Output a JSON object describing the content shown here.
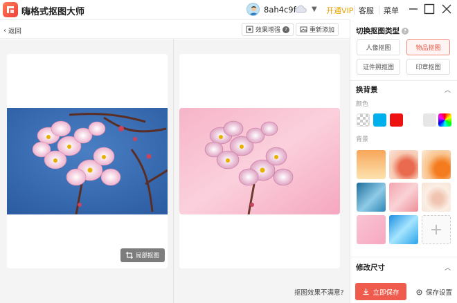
{
  "app": {
    "title": "嗨格式抠图大师"
  },
  "user": {
    "name": "8ah4c9f",
    "vip_label": "开通VIP",
    "service_label": "客服",
    "menu_label": "菜单"
  },
  "toolbar": {
    "back_label": "返回",
    "effect_label": "效果增强",
    "effect_help": "?",
    "readd_label": "重新添加"
  },
  "work": {
    "local_cutout_label": "局部抠图",
    "unsatisfied_label": "抠图效果不满意?"
  },
  "side": {
    "switch_type_title": "切换抠图类型",
    "types": [
      {
        "label": "人像抠图",
        "active": false
      },
      {
        "label": "物品抠图",
        "active": true
      },
      {
        "label": "证件照抠图",
        "active": false
      },
      {
        "label": "印章抠图",
        "active": false
      }
    ],
    "replace_bg_title": "换背景",
    "color_label": "颜色",
    "colors": [
      "transparent",
      "#00b0ec",
      "#ee1111",
      "#ffffff",
      "#e6e6e6",
      "rainbow"
    ],
    "bg_label": "背景",
    "backgrounds": [
      "bg-peach",
      "bg-flower-coral",
      "bg-orange-glow",
      "bg-blue-wave",
      "bg-pink-abstract",
      "bg-cream-floral",
      "bg-pink-soft",
      "bg-blue-shine",
      "add-custom"
    ],
    "resize_title": "修改尺寸",
    "save_label": "立即保存",
    "save_settings_label": "保存设置"
  },
  "colors": {
    "accent": "#ef5b4d",
    "vip": "#e8a200"
  }
}
